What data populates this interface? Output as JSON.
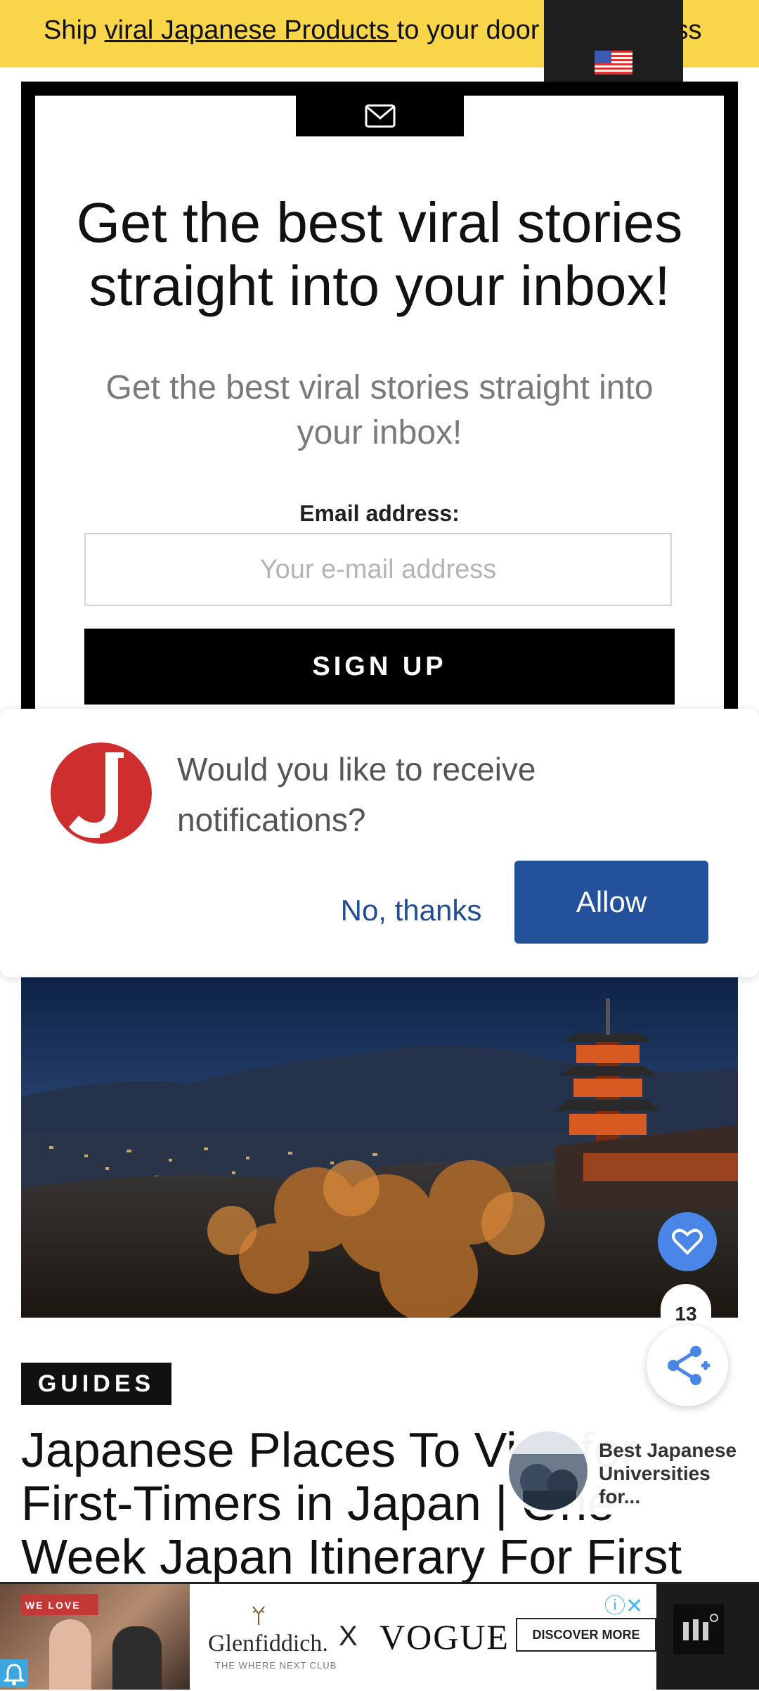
{
  "promo": {
    "text_before": "Ship ",
    "link": "viral Japanese Products ",
    "text_after": "to your door",
    "tail": "iss",
    "flag_icon": "us-flag-icon"
  },
  "signup": {
    "mail_icon": "mail-icon",
    "title": "Get the best viral stories straight into your inbox!",
    "subtitle": "Get the best viral stories straight into your inbox!",
    "email_label": "Email address:",
    "email_placeholder": "Your e-mail address",
    "button": "SIGN UP"
  },
  "notification": {
    "message": "Would you like to receive notifications?",
    "deny": "No, thanks",
    "allow": "Allow",
    "accent": "#23519c"
  },
  "article": {
    "like_count": "13",
    "tag": "GUIDES",
    "title": "Japanese Places To Visit for First-Timers in Japan | One Week Japan Itinerary For First"
  },
  "recommendation": {
    "title": "Best Japanese Universities for..."
  },
  "ad": {
    "video_text": "WE LOVE",
    "brand1": "Glenfiddich.",
    "brand1_sub": "THE WHERE NEXT CLUB",
    "x": "X",
    "brand2": "VOGUE",
    "cta": "DISCOVER MORE",
    "close": "ⓘ✕"
  }
}
